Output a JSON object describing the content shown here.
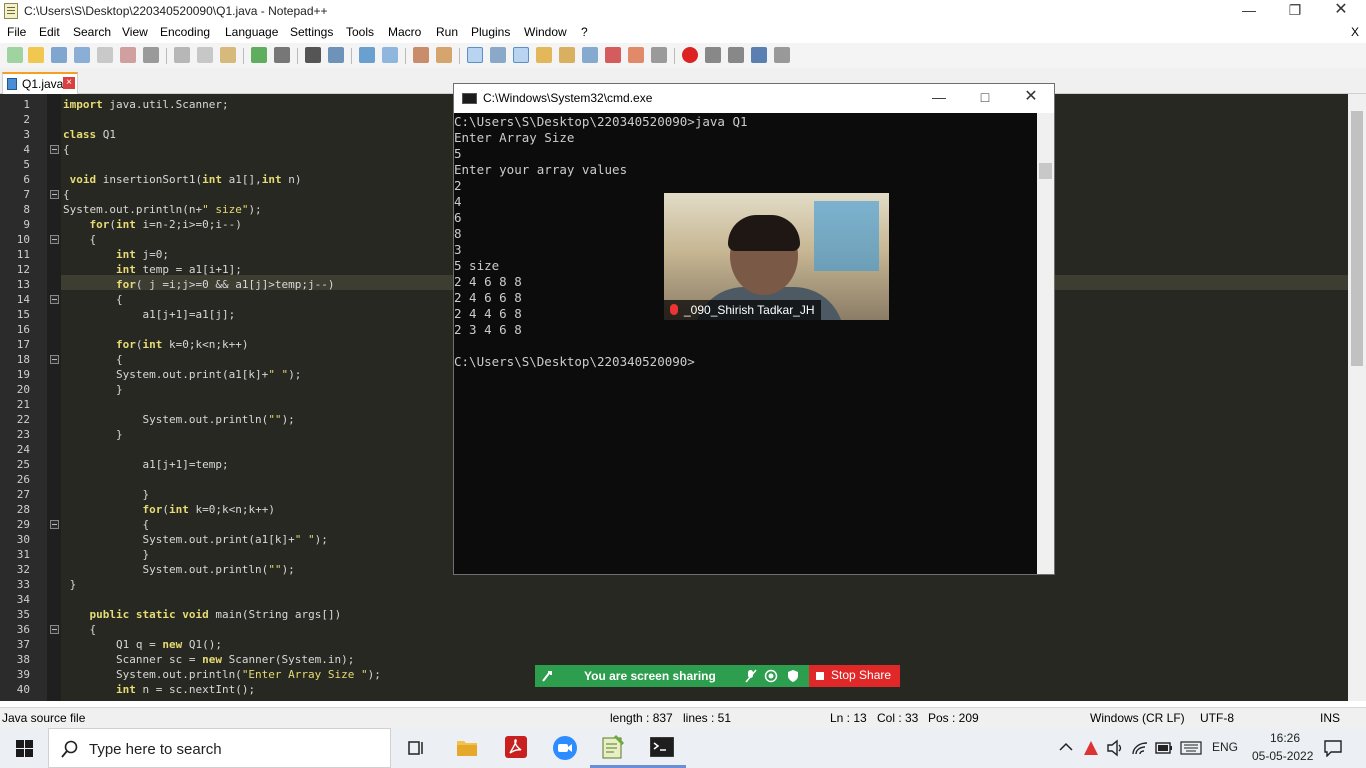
{
  "notepad": {
    "title": "C:\\Users\\S\\Desktop\\220340520090\\Q1.java - Notepad++",
    "menu": [
      "File",
      "Edit",
      "Search",
      "View",
      "Encoding",
      "Language",
      "Settings",
      "Tools",
      "Macro",
      "Run",
      "Plugins",
      "Window",
      "?"
    ],
    "menu_close": "X",
    "tab_label": "Q1.java",
    "tab_close": "×",
    "lines": [
      {
        "n": "1",
        "text": "import java.util.Scanner;"
      },
      {
        "n": "2",
        "text": ""
      },
      {
        "n": "3",
        "text": "class Q1"
      },
      {
        "n": "4",
        "text": "{"
      },
      {
        "n": "5",
        "text": ""
      },
      {
        "n": "6",
        "text": " void insertionSort1(int a1[],int n)"
      },
      {
        "n": "7",
        "text": "{"
      },
      {
        "n": "8",
        "text": "System.out.println(n+\" size\");"
      },
      {
        "n": "9",
        "text": "    for(int i=n-2;i>=0;i--)"
      },
      {
        "n": "10",
        "text": "    {"
      },
      {
        "n": "11",
        "text": "        int j=0;"
      },
      {
        "n": "12",
        "text": "        int temp = a1[i+1];"
      },
      {
        "n": "13",
        "text": "        for( j =i;j>=0 && a1[j]>temp;j--)"
      },
      {
        "n": "14",
        "text": "        {"
      },
      {
        "n": "15",
        "text": "            a1[j+1]=a1[j];"
      },
      {
        "n": "16",
        "text": ""
      },
      {
        "n": "17",
        "text": "        for(int k=0;k<n;k++)"
      },
      {
        "n": "18",
        "text": "        {"
      },
      {
        "n": "19",
        "text": "        System.out.print(a1[k]+\" \");"
      },
      {
        "n": "20",
        "text": "        }"
      },
      {
        "n": "21",
        "text": ""
      },
      {
        "n": "22",
        "text": "            System.out.println(\"\");"
      },
      {
        "n": "23",
        "text": "        }"
      },
      {
        "n": "24",
        "text": ""
      },
      {
        "n": "25",
        "text": "            a1[j+1]=temp;"
      },
      {
        "n": "26",
        "text": ""
      },
      {
        "n": "27",
        "text": "            }"
      },
      {
        "n": "28",
        "text": "            for(int k=0;k<n;k++)"
      },
      {
        "n": "29",
        "text": "            {"
      },
      {
        "n": "30",
        "text": "            System.out.print(a1[k]+\" \");"
      },
      {
        "n": "31",
        "text": "            }"
      },
      {
        "n": "32",
        "text": "            System.out.println(\"\");"
      },
      {
        "n": "33",
        "text": " }"
      },
      {
        "n": "34",
        "text": ""
      },
      {
        "n": "35",
        "text": "    public static void main(String args[])"
      },
      {
        "n": "36",
        "text": "    {"
      },
      {
        "n": "37",
        "text": "        Q1 q = new Q1();"
      },
      {
        "n": "38",
        "text": "        Scanner sc = new Scanner(System.in);"
      },
      {
        "n": "39",
        "text": "        System.out.println(\"Enter Array Size \");"
      },
      {
        "n": "40",
        "text": "        int n = sc.nextInt();"
      }
    ],
    "status": {
      "type": "Java source file",
      "length": "length : 837",
      "lines": "lines : 51",
      "ln": "Ln : 13",
      "col": "Col : 33",
      "pos": "Pos : 209",
      "eol": "Windows (CR LF)",
      "encoding": "UTF-8",
      "mode": "INS"
    }
  },
  "cmd": {
    "title": "C:\\Windows\\System32\\cmd.exe",
    "lines": [
      "C:\\Users\\S\\Desktop\\220340520090>java Q1",
      "Enter Array Size",
      "5",
      "Enter your array values",
      "2",
      "4",
      "6",
      "8",
      "3",
      "5 size",
      "2 4 6 8 8",
      "2 4 6 6 8",
      "2 4 4 6 8",
      "2 3 4 6 8",
      "",
      "C:\\Users\\S\\Desktop\\220340520090>"
    ]
  },
  "webcam": {
    "name": "_090_Shirish Tadkar_JH"
  },
  "share": {
    "label": "You are screen sharing",
    "stop": "Stop Share"
  },
  "taskbar": {
    "search_placeholder": "Type here to search",
    "lang": "ENG",
    "time": "16:26",
    "date": "05-05-2022"
  },
  "colors": {
    "accent_tab": "#f4a021",
    "share_green": "#2d9d4e",
    "stop_red": "#e02828",
    "editor_bg": "#272822"
  }
}
